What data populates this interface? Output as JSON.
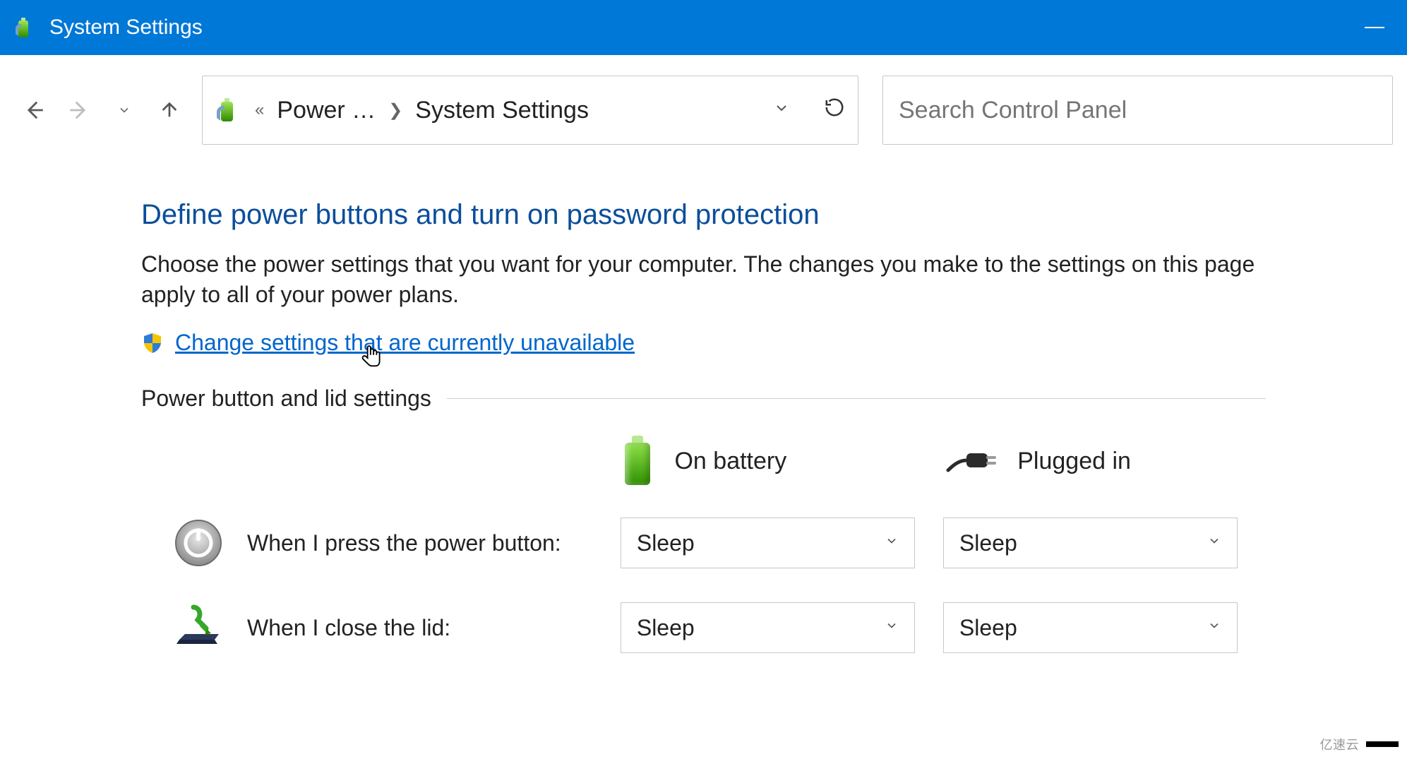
{
  "titlebar": {
    "title": "System Settings"
  },
  "nav": {
    "breadcrumb_prefix_glyph": "«",
    "crumb1": "Power …",
    "crumb2": "System Settings",
    "search_placeholder": "Search Control Panel"
  },
  "page": {
    "heading": "Define power buttons and turn on password protection",
    "description": "Choose the power settings that you want for your computer. The changes you make to the settings on this page apply to all of your power plans.",
    "admin_link": "Change settings that are currently unavailable",
    "section_header": "Power button and lid settings",
    "col_battery": "On battery",
    "col_plugged": "Plugged in",
    "rows": [
      {
        "label": "When I press the power button:",
        "battery_value": "Sleep",
        "plugged_value": "Sleep"
      },
      {
        "label": "When I close the lid:",
        "battery_value": "Sleep",
        "plugged_value": "Sleep"
      }
    ]
  },
  "watermark": "亿速云"
}
